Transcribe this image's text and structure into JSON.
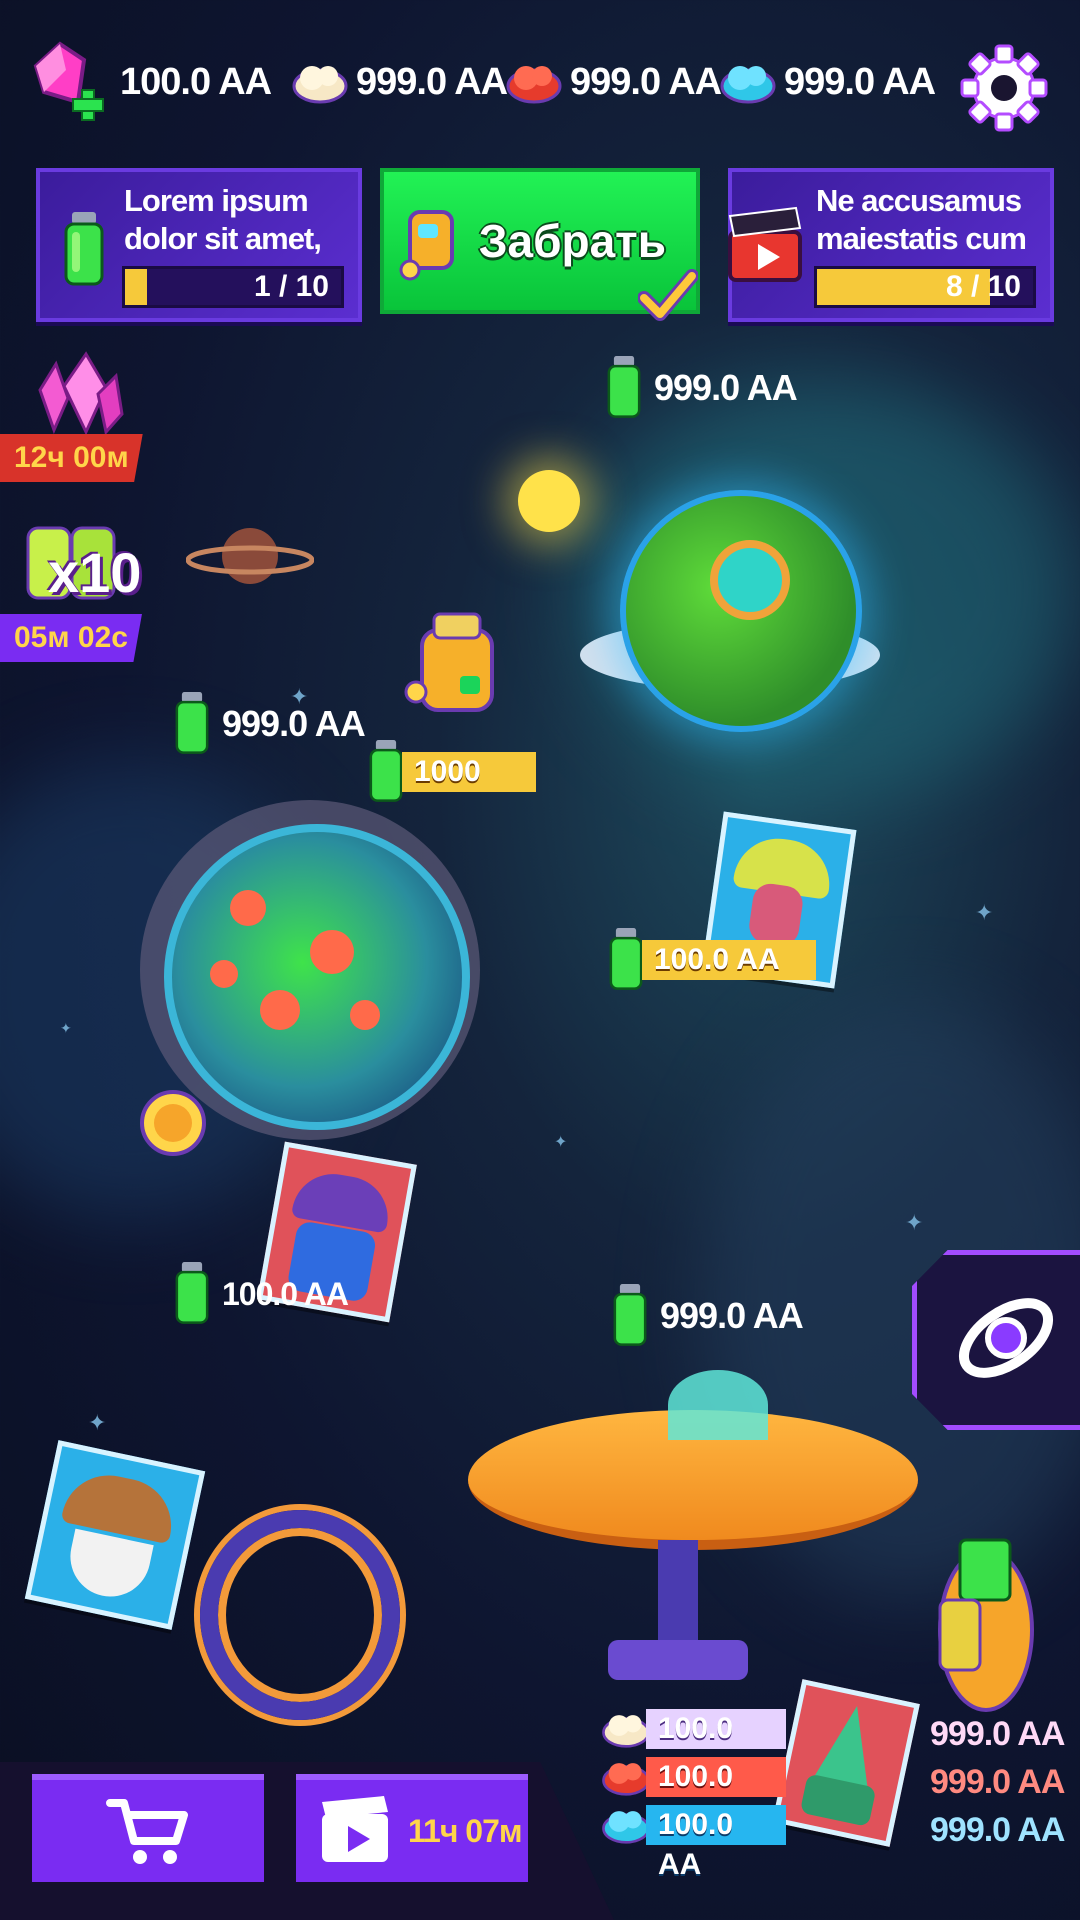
{
  "resources": {
    "gems": "100.0 AA",
    "cloud_white": "999.0 AA",
    "cloud_red": "999.0 AA",
    "cloud_blue": "999.0 AA"
  },
  "quests": {
    "left": {
      "text": "Lorem ipsum dolor sit amet, net nec",
      "progress_label": "1 / 10",
      "progress": 0.1
    },
    "claim_label": "Забрать",
    "right": {
      "text": "Ne accusamus maiestatis cum",
      "progress_label": "8 / 10",
      "progress": 0.8
    }
  },
  "side": {
    "crystal_timer": "12ч 00м",
    "boost_multiplier": "x10",
    "boost_timer": "05м 02с"
  },
  "map": {
    "planet1_income": "999.0 AA",
    "planet2_income": "999.0 AA",
    "ship_cost": "1000",
    "mushroom_income": "100.0 AA",
    "wizard_income": "100.0 AA",
    "base_income": "999.0 AA"
  },
  "base": {
    "costs": [
      "100.0 AA",
      "100.0 AA",
      "100.0 AA"
    ],
    "totals": [
      "999.0 AA",
      "999.0 AA",
      "999.0 AA"
    ],
    "total_colors": [
      "#ffd9f6",
      "#ff8a80",
      "#9fe3ff"
    ]
  },
  "bottom": {
    "video_timer": "11ч 07м"
  },
  "colors": {
    "accent": "#7a2cf2",
    "green": "#19e04a",
    "gold": "#f6c93a"
  }
}
